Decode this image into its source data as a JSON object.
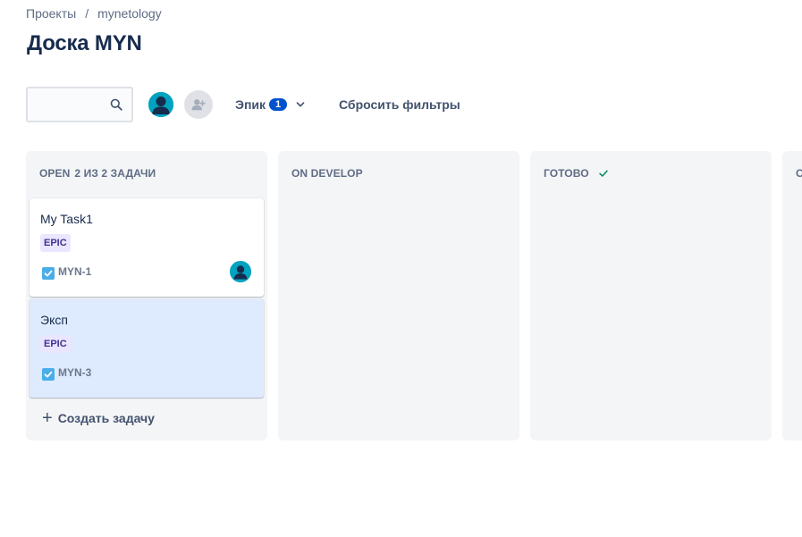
{
  "breadcrumbs": {
    "items": [
      "Проекты",
      "mynetology"
    ],
    "separator": "/"
  },
  "page": {
    "title": "Доска MYN"
  },
  "toolbar": {
    "search": {
      "value": "",
      "placeholder": "",
      "icon": "search-icon"
    },
    "epic_filter": {
      "label": "Эпик",
      "count": "1"
    },
    "reset_label": "Сбросить фильтры"
  },
  "columns": [
    {
      "name": "OPEN",
      "count": "2 ИЗ 2 ЗАДАЧИ",
      "cards": [
        {
          "title": "My Task1",
          "epic": "EPIC",
          "key": "MYN-1",
          "has_assignee": true
        },
        {
          "title": "Эксп",
          "epic": "EPIC",
          "key": "MYN-3",
          "has_assignee": false
        }
      ],
      "create_label": "Создать задачу"
    },
    {
      "name": "ON DEVELOP"
    },
    {
      "name": "ГОТОВО",
      "done": true
    },
    {
      "name": "С"
    }
  ],
  "colors": {
    "brand_blue": "#0052cc",
    "avatar": "#00a3bf",
    "epic_bg": "#eae6ff",
    "epic_text": "#403294",
    "selected_card": "#deebff",
    "done_check": "#00875a"
  }
}
